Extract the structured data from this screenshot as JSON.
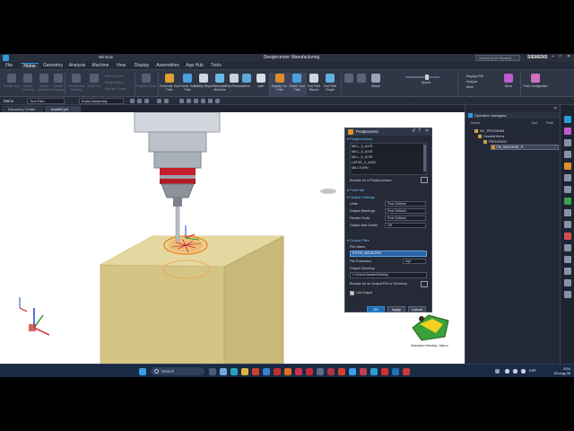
{
  "app": {
    "title": "Designcenter Manufacturing",
    "search_placeholder": "Search (Ctrl+Space)",
    "brand": "SIEMENS"
  },
  "menu": {
    "tabs": [
      "File",
      "Home",
      "Geometry",
      "Analysis",
      "Machine",
      "View",
      "Display",
      "Assemblies",
      "App Hub",
      "Tools"
    ],
    "window_label": "Window"
  },
  "ribbon": {
    "groups": [
      "Insert",
      "Pocket Operations",
      "Actions",
      "Operations",
      "Display",
      "Tool Path Animation",
      "XPost",
      "Tools"
    ],
    "buttons": [
      {
        "label": "Create Tool",
        "dim": true
      },
      {
        "label": "Create Geometry",
        "dim": true
      },
      {
        "label": "Create Operation",
        "dim": true
      },
      {
        "label": "Create Program",
        "dim": true
      },
      {
        "label": "On Machine Probing",
        "dim": true
      },
      {
        "label": "Verify Tool",
        "dim": true
      },
      {
        "label": "Program Order",
        "dim": true
      },
      {
        "label": "Generate Tool Path",
        "dim": false
      },
      {
        "label": "Check Tool Path",
        "dim": false
      },
      {
        "label": "Validity Report",
        "dim": false
      },
      {
        "label": "Simulate Machine",
        "dim": false
      },
      {
        "label": "Post Process",
        "dim": false
      },
      {
        "label": "More",
        "dim": false
      },
      {
        "label": "path",
        "dim": false
      },
      {
        "label": "Display Tool Path",
        "dim": false
      },
      {
        "label": "Select Tool Path",
        "dim": false
      },
      {
        "label": "Tool Path Report",
        "dim": false
      },
      {
        "label": "Tool Path Graph",
        "dim": false
      },
      {
        "label": "Attach",
        "dim": false
      },
      {
        "label": "Speed",
        "dim": false
      },
      {
        "label": "Move",
        "dim": false
      },
      {
        "label": "Post Configurator",
        "dim": false
      }
    ],
    "small": [
      "Remove Axis",
      "Merge Button",
      "Machine Shape",
      "Limited Button",
      "Set Button"
    ],
    "display_small": [
      "Display IPW",
      "Analyze",
      "More"
    ]
  },
  "toolbar2": {
    "menu_label": "Menu",
    "combo1": "Tool Path",
    "combo2": "Entire Assembly"
  },
  "doc_tabs": [
    "Discovery Center",
    "model1.prt"
  ],
  "dialog": {
    "title": "Postprocess",
    "sections": {
      "postprocessor": "Postprocessor",
      "post_hint": "Post Hint",
      "output_settings": "Output Settings",
      "output_files": "Output Files"
    },
    "post_list": [
      "MILL_3_AXIS",
      "MILL_4_AXIS",
      "MILL_5_AXIS",
      "LATHE_2_AXIS",
      "MILLTURN"
    ],
    "browse_post": "Browse for a Postprocessor",
    "settings": [
      {
        "label": "Units",
        "value": "Post Defined"
      },
      {
        "label": "Output Warnings",
        "value": "Post Defined"
      },
      {
        "label": "Review Tools",
        "value": "Post Defined"
      },
      {
        "label": "Output Ball Center",
        "value": "Off"
      }
    ],
    "file_name_label": "File Name",
    "file_name_value": "ESTIR_MEJAORO",
    "file_ext_label": "File Extension",
    "file_ext_value": "mpf",
    "out_dir_label": "Output Directory",
    "out_dir_value": "C:\\Users\\Jander\\Desktop",
    "browse_output": "Browse for an Output File or Directory",
    "list_output": "List Output",
    "buttons": [
      "OK",
      "Apply",
      "Cancel"
    ]
  },
  "navigator": {
    "title": "Operation Navigator",
    "columns": [
      "Name",
      "Path",
      "Tool"
    ],
    "items": [
      "NC_PROGRAM",
      "Unused Items",
      "PROGRAM",
      "CM_MACHINE_P..."
    ]
  },
  "watermark": "Sebastian Mandujo Jalisco",
  "taskbar": {
    "search": "Search",
    "lang": "ESP",
    "time": "8:54",
    "date": "28-Aug-36"
  },
  "colors": {
    "accent": "#2f9ad6",
    "part": "#d7c890",
    "toolpath": "#f08a24"
  }
}
